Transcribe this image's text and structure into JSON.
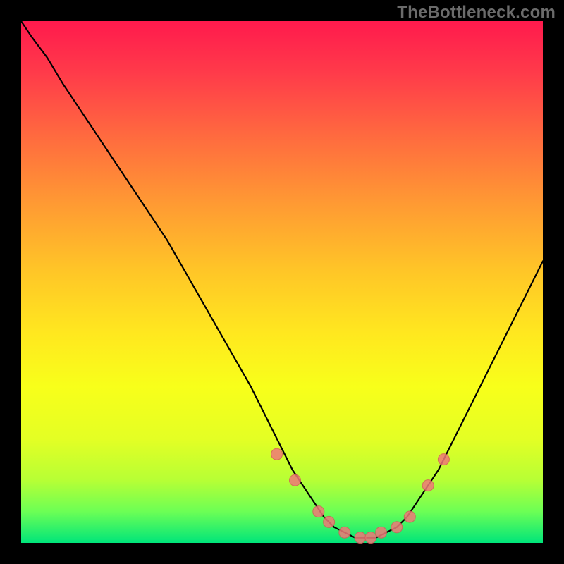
{
  "watermark": "TheBottleneck.com",
  "colors": {
    "background": "#000000",
    "gradient_top": "#ff1a4d",
    "gradient_bottom": "#00e57a",
    "curve": "#000000",
    "marker_fill": "#f07878",
    "marker_stroke": "#d85a5a"
  },
  "chart_data": {
    "type": "line",
    "title": "",
    "xlabel": "",
    "ylabel": "",
    "xlim": [
      0,
      100
    ],
    "ylim": [
      0,
      100
    ],
    "grid": false,
    "series": [
      {
        "name": "bottleneck-curve",
        "x": [
          0,
          2,
          5,
          8,
          12,
          16,
          20,
          24,
          28,
          32,
          36,
          40,
          44,
          46,
          48,
          50,
          52,
          54,
          56,
          58,
          60,
          62,
          64,
          66,
          68,
          70,
          72,
          74,
          76,
          80,
          84,
          88,
          92,
          96,
          100
        ],
        "y": [
          100,
          97,
          93,
          88,
          82,
          76,
          70,
          64,
          58,
          51,
          44,
          37,
          30,
          26,
          22,
          18,
          14,
          11,
          8,
          5,
          3,
          2,
          1,
          1,
          1,
          2,
          3,
          5,
          8,
          14,
          22,
          30,
          38,
          46,
          54
        ]
      }
    ],
    "markers": {
      "name": "hotspots",
      "x": [
        49,
        52.5,
        57,
        59,
        62,
        65,
        67,
        69,
        72,
        74.5,
        78,
        81
      ],
      "y": [
        17,
        12,
        6,
        4,
        2,
        1,
        1,
        2,
        3,
        5,
        11,
        16
      ]
    }
  }
}
